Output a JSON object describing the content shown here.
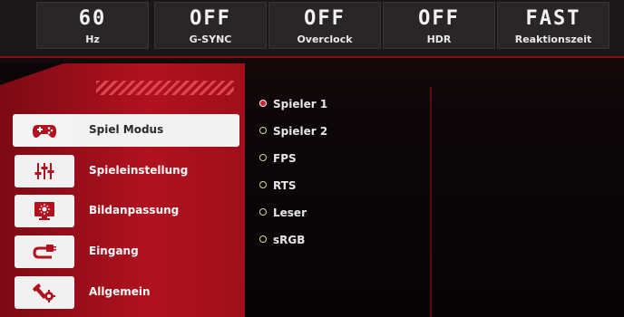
{
  "status": [
    {
      "value": "60",
      "label": "Hz"
    },
    {
      "value": "OFF",
      "label": "G-SYNC"
    },
    {
      "value": "OFF",
      "label": "Overclock"
    },
    {
      "value": "OFF",
      "label": "HDR"
    },
    {
      "value": "FAST",
      "label": "Reaktionszeit"
    }
  ],
  "menu": [
    {
      "label": "Spiel Modus",
      "icon": "gamepad-icon",
      "selected": true
    },
    {
      "label": "Spieleinstellung",
      "icon": "sliders-icon",
      "selected": false
    },
    {
      "label": "Bildanpassung",
      "icon": "monitor-brightness-icon",
      "selected": false
    },
    {
      "label": "Eingang",
      "icon": "input-cable-icon",
      "selected": false
    },
    {
      "label": "Allgemein",
      "icon": "wrench-gear-icon",
      "selected": false
    }
  ],
  "options": [
    {
      "label": "Spieler 1",
      "selected": true
    },
    {
      "label": "Spieler 2",
      "selected": false
    },
    {
      "label": "FPS",
      "selected": false
    },
    {
      "label": "RTS",
      "selected": false
    },
    {
      "label": "Leser",
      "selected": false
    },
    {
      "label": "sRGB",
      "selected": false
    }
  ],
  "colors": {
    "accent": "#a8101c",
    "selected_radio": "#d41c2a"
  }
}
